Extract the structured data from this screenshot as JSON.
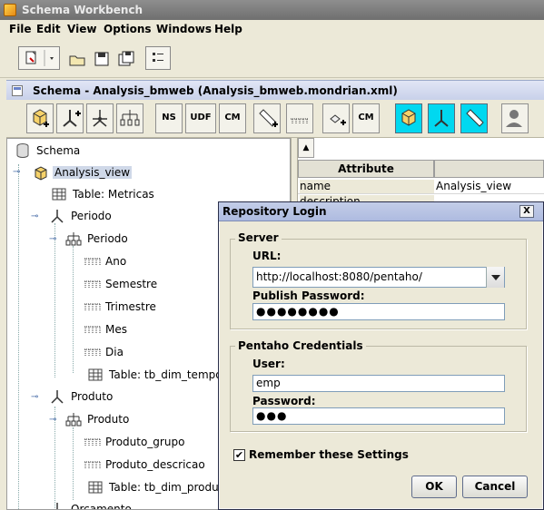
{
  "window": {
    "title": "Schema Workbench"
  },
  "menu": [
    {
      "label": "File",
      "mnemonic": "F"
    },
    {
      "label": "Edit",
      "mnemonic": "E"
    },
    {
      "label": "View",
      "mnemonic": "V"
    },
    {
      "label": "Options",
      "mnemonic": "O"
    },
    {
      "label": "Windows",
      "mnemonic": "W"
    },
    {
      "label": "Help",
      "mnemonic": "H"
    }
  ],
  "internal_frame": {
    "title": "Schema - Analysis_bmweb (Analysis_bmweb.mondrian.xml)"
  },
  "schema_toolbar": {
    "buttons": [
      "add-cube",
      "add-dimension",
      "add-dimension-usage",
      "add-hierarchy",
      "NS",
      "UDF",
      "CM",
      "add-measure",
      "add-level",
      "add-property",
      "CM",
      "cut",
      "copy",
      "paste",
      "add-role"
    ]
  },
  "tree": {
    "nodes": [
      {
        "label": "Schema"
      },
      {
        "label": "Analysis_view"
      },
      {
        "label": "Table: Metricas"
      },
      {
        "label": "Periodo"
      },
      {
        "label": "Periodo"
      },
      {
        "label": "Ano"
      },
      {
        "label": "Semestre"
      },
      {
        "label": "Trimestre"
      },
      {
        "label": "Mes"
      },
      {
        "label": "Dia"
      },
      {
        "label": "Table: tb_dim_tempo"
      },
      {
        "label": "Produto"
      },
      {
        "label": "Produto"
      },
      {
        "label": "Produto_grupo"
      },
      {
        "label": "Produto_descricao"
      },
      {
        "label": "Table: tb_dim_produto"
      },
      {
        "label": "Orcamento"
      }
    ]
  },
  "attributes": {
    "header": "Attribute",
    "rows": [
      {
        "key": "name",
        "value": "Analysis_view"
      },
      {
        "key": "description",
        "value": ""
      }
    ]
  },
  "dialog": {
    "title": "Repository Login",
    "close_label": "X",
    "server_group": "Server",
    "url_label": "URL:",
    "url_value": "http://localhost:8080/pentaho/",
    "publish_password_label": "Publish Password:",
    "publish_password_value": "●●●●●●●●",
    "credentials_group": "Pentaho Credentials",
    "user_label": "User:",
    "user_value": "emp",
    "password_label": "Password:",
    "password_value": "●●●",
    "remember_label": "Remember these Settings",
    "remember_checked": "✔",
    "ok_label": "OK",
    "cancel_label": "Cancel"
  }
}
